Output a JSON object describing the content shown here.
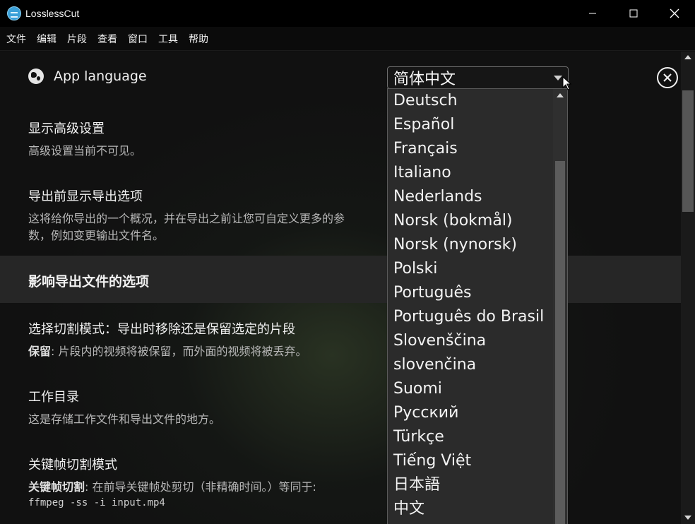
{
  "window": {
    "title": "LosslessCut",
    "minimize_icon": "minimize-icon",
    "maximize_icon": "maximize-icon",
    "close_icon": "close-icon"
  },
  "menu": [
    "文件",
    "编辑",
    "片段",
    "查看",
    "窗口",
    "工具",
    "帮助"
  ],
  "settings": {
    "language": {
      "label": "App language",
      "icon": "globe-icon",
      "selected": "简体中文"
    },
    "advanced": {
      "title": "显示高级设置",
      "desc": "高级设置当前不可见。"
    },
    "export_options": {
      "title": "导出前显示导出选项",
      "desc": "这将给你导出的一个概况，并在导出之前让您可自定义更多的参数，例如变更输出文件名。"
    },
    "section_title": "影响导出文件的选项",
    "cut_mode": {
      "title": "选择切割模式：导出时移除还是保留选定的片段",
      "desc_bold": "保留",
      "desc_rest": ": 片段内的视频将被保留，而外面的视频将被丢弃。"
    },
    "work_dir": {
      "title": "工作目录",
      "desc": "这是存储工作文件和导出文件的地方。"
    },
    "keyframe": {
      "title": "关键帧切割模式",
      "desc_bold": "关键帧切割",
      "desc_rest": ": 在前导关键帧处剪切（非精确时间。）等同于:",
      "command": "ffmpeg -ss -i input.mp4"
    }
  },
  "dropdown": {
    "options": [
      "Deutsch",
      "Español",
      "Français",
      "Italiano",
      "Nederlands",
      "Norsk (bokmål)",
      "Norsk (nynorsk)",
      "Polski",
      "Português",
      "Português do Brasil",
      "Slovenščina",
      "slovenčina",
      "Suomi",
      "Русский",
      "Türkçe",
      "Tiếng Việt",
      "日本語",
      "中文"
    ]
  },
  "colors": {
    "background": "#111111",
    "section_band": "#262626",
    "dropdown_bg": "#2b2b2b",
    "app_icon": "#3aa0d8"
  }
}
